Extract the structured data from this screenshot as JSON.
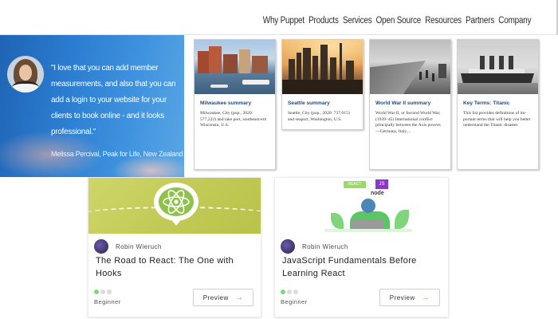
{
  "nav": {
    "items": [
      "Why Puppet",
      "Products",
      "Services",
      "Open Source",
      "Resources",
      "Partners",
      "Company"
    ]
  },
  "testimonial": {
    "quote": "\"I love that you can add member measurements, and also that you can add a login to your website for your clients to book online - and it looks professional.\"",
    "author": "Melissa Percival, Peak for Life, New Zealand"
  },
  "summaries": [
    {
      "title": "Milwaukee summary",
      "text": "Milwaukee, City (pop., 2020: 577,222) and lake port, southeast-ern Wisconsin, U.S.",
      "image": "milwaukee-harbor-photo"
    },
    {
      "title": "Seattle summary",
      "text": "Seattle, City (pop., 2020: 737,015) and seaport, Washington, U.S.",
      "image": "seattle-skyline-photo"
    },
    {
      "title": "World War II summary",
      "text": "World War II, or Second World War, (1939–45) International conflict principally between the Axis powers—Germany, Italy,...",
      "image": "ww2-soldiers-photo"
    },
    {
      "title": "Key Terms: Titanic",
      "text": "This list provides definitions of im-portant terms that will help you better understand the Titanic disaster.",
      "image": "titanic-ship-photo"
    }
  ],
  "courses": [
    {
      "author": "Robin Wieruch",
      "title": "The Road to React: The One with Hooks",
      "level": "Beginner",
      "level_dots": 1,
      "preview_label": "Preview",
      "banner": "react-atom-banner"
    },
    {
      "author": "Robin Wieruch",
      "title": "JavaScript Fundamentals Before Learning React",
      "level": "Beginner",
      "level_dots": 1,
      "preview_label": "Preview",
      "banner": "js-node-react-banner",
      "badges": [
        "REACT",
        "JS",
        "node"
      ]
    }
  ],
  "colors": {
    "hero_blue": "#2b7cd0",
    "card_title": "#2a4b7c",
    "react_banner": "#c2cb56",
    "accent_green": "#5dbf5a"
  }
}
